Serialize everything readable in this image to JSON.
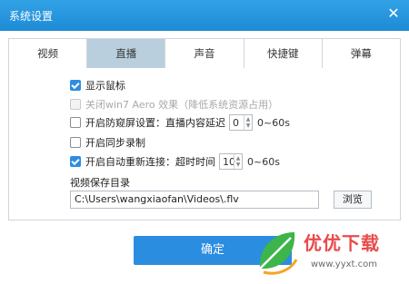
{
  "window": {
    "title": "系统设置",
    "close_label": "✕"
  },
  "tabs": [
    {
      "label": "视频",
      "active": false
    },
    {
      "label": "直播",
      "active": true
    },
    {
      "label": "声音",
      "active": false
    },
    {
      "label": "快捷键",
      "active": false
    },
    {
      "label": "弹幕",
      "active": false
    }
  ],
  "options": {
    "show_cursor": {
      "label": "显示鼠标",
      "checked": true
    },
    "disable_aero": {
      "label": "关闭win7 Aero 效果（降低系统资源占用）",
      "checked": false,
      "disabled": true
    },
    "anti_peek": {
      "label": "开启防窥屏设置：直播内容延迟",
      "checked": false,
      "value": "0",
      "range": "0~60s"
    },
    "sync_record": {
      "label": "开启同步录制",
      "checked": false
    },
    "auto_reconnect": {
      "label": "开启自动重新连接：超时时间",
      "checked": true,
      "value": "10",
      "range": "0~60s"
    }
  },
  "save_dir": {
    "label": "视频保存目录",
    "path": "C:\\Users\\wangxiaofan\\Videos\\.flv",
    "browse_label": "浏览"
  },
  "ok_label": "确定",
  "watermark": {
    "brand": "优优下载",
    "url": "www.yyxt.com"
  },
  "colors": {
    "titlebar": "#1e8bd6",
    "accent": "#2b8de0",
    "active_tab": "#b9cfde",
    "watermark": "#e94b4b"
  }
}
